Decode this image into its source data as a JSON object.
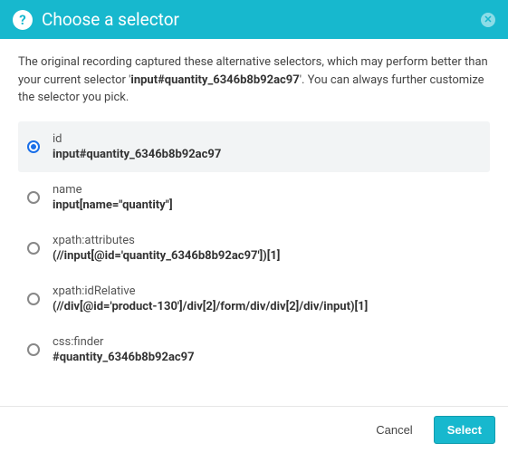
{
  "header": {
    "title": "Choose a selector"
  },
  "intro": {
    "before": "The original recording captured these alternative selectors, which may perform better than your current selector '",
    "highlight": "input#quantity_6346b8b92ac97",
    "after": "'. You can always further customize the selector you pick."
  },
  "options": [
    {
      "type": "id",
      "value": "input#quantity_6346b8b92ac97",
      "selected": true
    },
    {
      "type": "name",
      "value": "input[name=\"quantity\"]",
      "selected": false
    },
    {
      "type": "xpath:attributes",
      "value": "(//input[@id='quantity_6346b8b92ac97'])[1]",
      "selected": false
    },
    {
      "type": "xpath:idRelative",
      "value": "(//div[@id='product-130']/div[2]/form/div/div[2]/div/input)[1]",
      "selected": false
    },
    {
      "type": "css:finder",
      "value": "#quantity_6346b8b92ac97",
      "selected": false
    }
  ],
  "footer": {
    "cancel": "Cancel",
    "select": "Select"
  }
}
